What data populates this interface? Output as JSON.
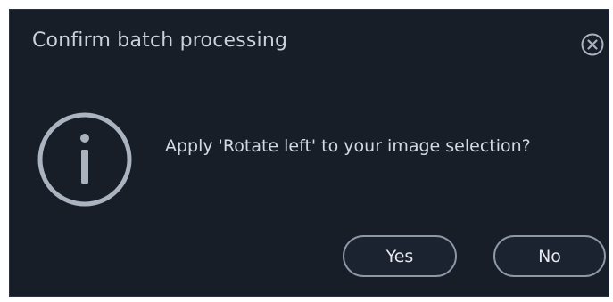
{
  "dialog": {
    "title": "Confirm batch processing",
    "message": "Apply 'Rotate left' to your image selection?",
    "icon": "info-icon",
    "close_icon": "close-icon",
    "buttons": {
      "yes_label": "Yes",
      "no_label": "No"
    }
  },
  "colors": {
    "background": "#181e28",
    "title_text": "#c9d1dc",
    "message_text": "#d3d9e2",
    "button_border": "#8d97a6",
    "icon_stroke": "#aab3c0"
  }
}
